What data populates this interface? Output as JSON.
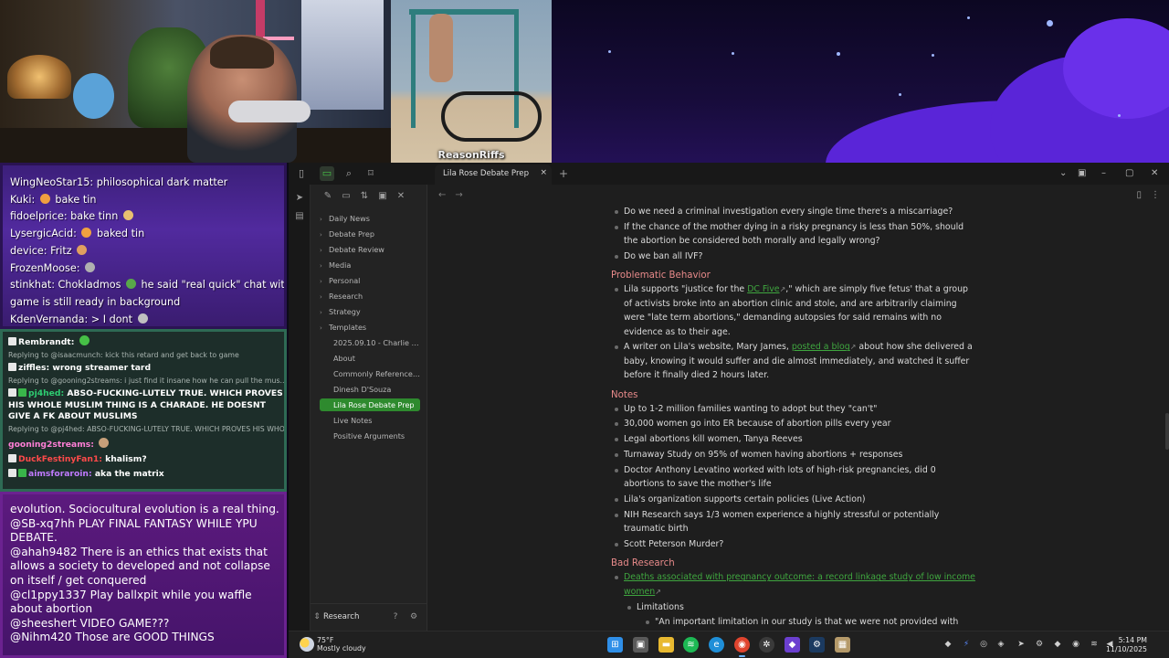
{
  "stream": {
    "caption": "ReasonRiffs"
  },
  "chat_top": [
    {
      "user": "WingNeoStar15:",
      "text": " philosophical dark matter",
      "emote": ""
    },
    {
      "user": "Kuki:",
      "text": " bake tin",
      "emote": "#f0a040"
    },
    {
      "user": "fidoelprice:",
      "text": " bake tinn",
      "emote_after": "#e9c070"
    },
    {
      "user": "LysergicAcid:",
      "text": " baked tin",
      "emote": "#f0a040"
    },
    {
      "user": "device:",
      "text": " Fritz",
      "emote_after": "#e0a060"
    },
    {
      "user": "FrozenMoose:",
      "text": "",
      "emote_after": "#b0b0b0"
    },
    {
      "user": "stinkhat:",
      "text": " Chokladmos",
      "emote_after": "#59a84a",
      "tail": " he said \"real quick\" chat with pp ,"
    },
    {
      "user": "",
      "text": "game is still ready in background",
      "emote": ""
    },
    {
      "user": "KdenVernanda:",
      "text": " > I dont",
      "emote_after": "#c0c0c0"
    }
  ],
  "chat_mid": {
    "m1_user": "Rembrandt:",
    "m1_user_color": "#e8e8e8",
    "r1": "Replying to @isaacmunch: kick this retard and get back to game",
    "m2_user": "ziffles:",
    "m2_text": " wrong streamer tard",
    "m2_user_color": "#e8e8e8",
    "r2": "Replying to @gooning2streams: i just find it insane how he can pull the mus...",
    "m3_user": "pj4hed:",
    "m3_text": " ABSO-FUCKING-LUTELY TRUE. WHICH PROVES HIS WHOLE MUSLIM THING IS A CHARADE. HE DOESNT GIVE A FK ABOUT MUSLIMS",
    "m3_user_color": "#2ecc71",
    "r3": "Replying to @pj4hed: ABSO-FUCKING-LUTELY TRUE. WHICH PROVES HIS WHO...",
    "m4_user": "gooning2streams:",
    "m4_user_color": "#ff7fd6",
    "m5_user": "DuckFestinyFan1:",
    "m5_text": " khalism?",
    "m5_user_color": "#ff4a4a",
    "m6_user": "aimsforaroin:",
    "m6_text": " aka the matrix",
    "m6_user_color": "#c07aff"
  },
  "chat_bottom": [
    "evolution. Sociocultural evolution is a real thing.",
    "@SB-xq7hh PLAY FINAL FANTASY WHILE YPU DEBATE.",
    "@ahah9482 There is an ethics that exists that allows a society to developed and not collapse on itself / get conquered",
    "@cl1ppy1337 Play ballxpit while you waffle about abortion",
    "@sheeshert VIDEO GAME???",
    "@Nihm420 Those are GOOD THINGS"
  ],
  "app": {
    "tab_title": "Lila Rose Debate Prep",
    "tab_close": "×",
    "tab_add": "+",
    "vault_name": "Research",
    "tree": [
      {
        "label": "Daily News",
        "folder": true
      },
      {
        "label": "Debate Prep",
        "folder": true
      },
      {
        "label": "Debate Review",
        "folder": true
      },
      {
        "label": "Media",
        "folder": true
      },
      {
        "label": "Personal",
        "folder": true
      },
      {
        "label": "Research",
        "folder": true
      },
      {
        "label": "Strategy",
        "folder": true
      },
      {
        "label": "Templates",
        "folder": true
      },
      {
        "label": "2025.09.10 - Charlie Kir...",
        "folder": false
      },
      {
        "label": "About",
        "folder": false
      },
      {
        "label": "Commonly Referenced ...",
        "folder": false
      },
      {
        "label": "Dinesh D'Souza",
        "folder": false
      },
      {
        "label": "Lila Rose Debate Prep",
        "folder": false,
        "active": true
      },
      {
        "label": "Live Notes",
        "folder": false
      },
      {
        "label": "Positive Arguments",
        "folder": false
      }
    ]
  },
  "note": {
    "q1": "Do we need a criminal investigation every single time there's a miscarriage?",
    "q2": "If the chance of the mother dying in a risky pregnancy is less than 50%, should the abortion be considered both morally and legally wrong?",
    "q3": "Do we ban all IVF?",
    "h_problematic": "Problematic Behavior",
    "pb1_a": "Lila supports \"justice for the ",
    "pb1_link": "DC Five",
    "pb1_b": ",\" which are simply five fetus' that a group of activists broke into an abortion clinic and stole, and are arbitrarily claiming were \"late term abortions,\" demanding autopsies for said remains with no evidence as to their age.",
    "pb2_a": "A writer on Lila's website, Mary James, ",
    "pb2_link": "posted a blog",
    "pb2_b": " about how she delivered a baby, knowing it would suffer and die almost immediately, and watched it suffer before it finally died 2 hours later.",
    "h_notes": "Notes",
    "n1": "Up to 1-2 million families wanting to adopt but they \"can't\"",
    "n2": "30,000 women go into ER because of abortion pills every year",
    "n3": "Legal abortions kill women, Tanya Reeves",
    "n4": "Turnaway Study on 95% of women having abortions + responses",
    "n5": "Doctor Anthony Levatino worked with lots of high-risk pregnancies, did 0 abortions to save the mother's life",
    "n6": "Lila's organization supports certain policies (Live Action)",
    "n7": "NIH Research says 1/3 women experience a highly stressful or potentially traumatic birth",
    "n8": "Scott Peterson Murder?",
    "h_bad": "Bad Research",
    "br_link": "Deaths associated with pregnancy outcome: a record linkage study of low income women",
    "br_limit": "Limitations",
    "br_quote": "\"An important limitation in our study is that we were not provided with any"
  },
  "taskbar": {
    "temp": "75°F",
    "condition": "Mostly cloudy",
    "time": "5:14 PM",
    "date": "11/10/2025"
  },
  "colors": {
    "accent": "#2e8a2e",
    "link": "#3fa63f",
    "heading": "#e88a8a"
  }
}
